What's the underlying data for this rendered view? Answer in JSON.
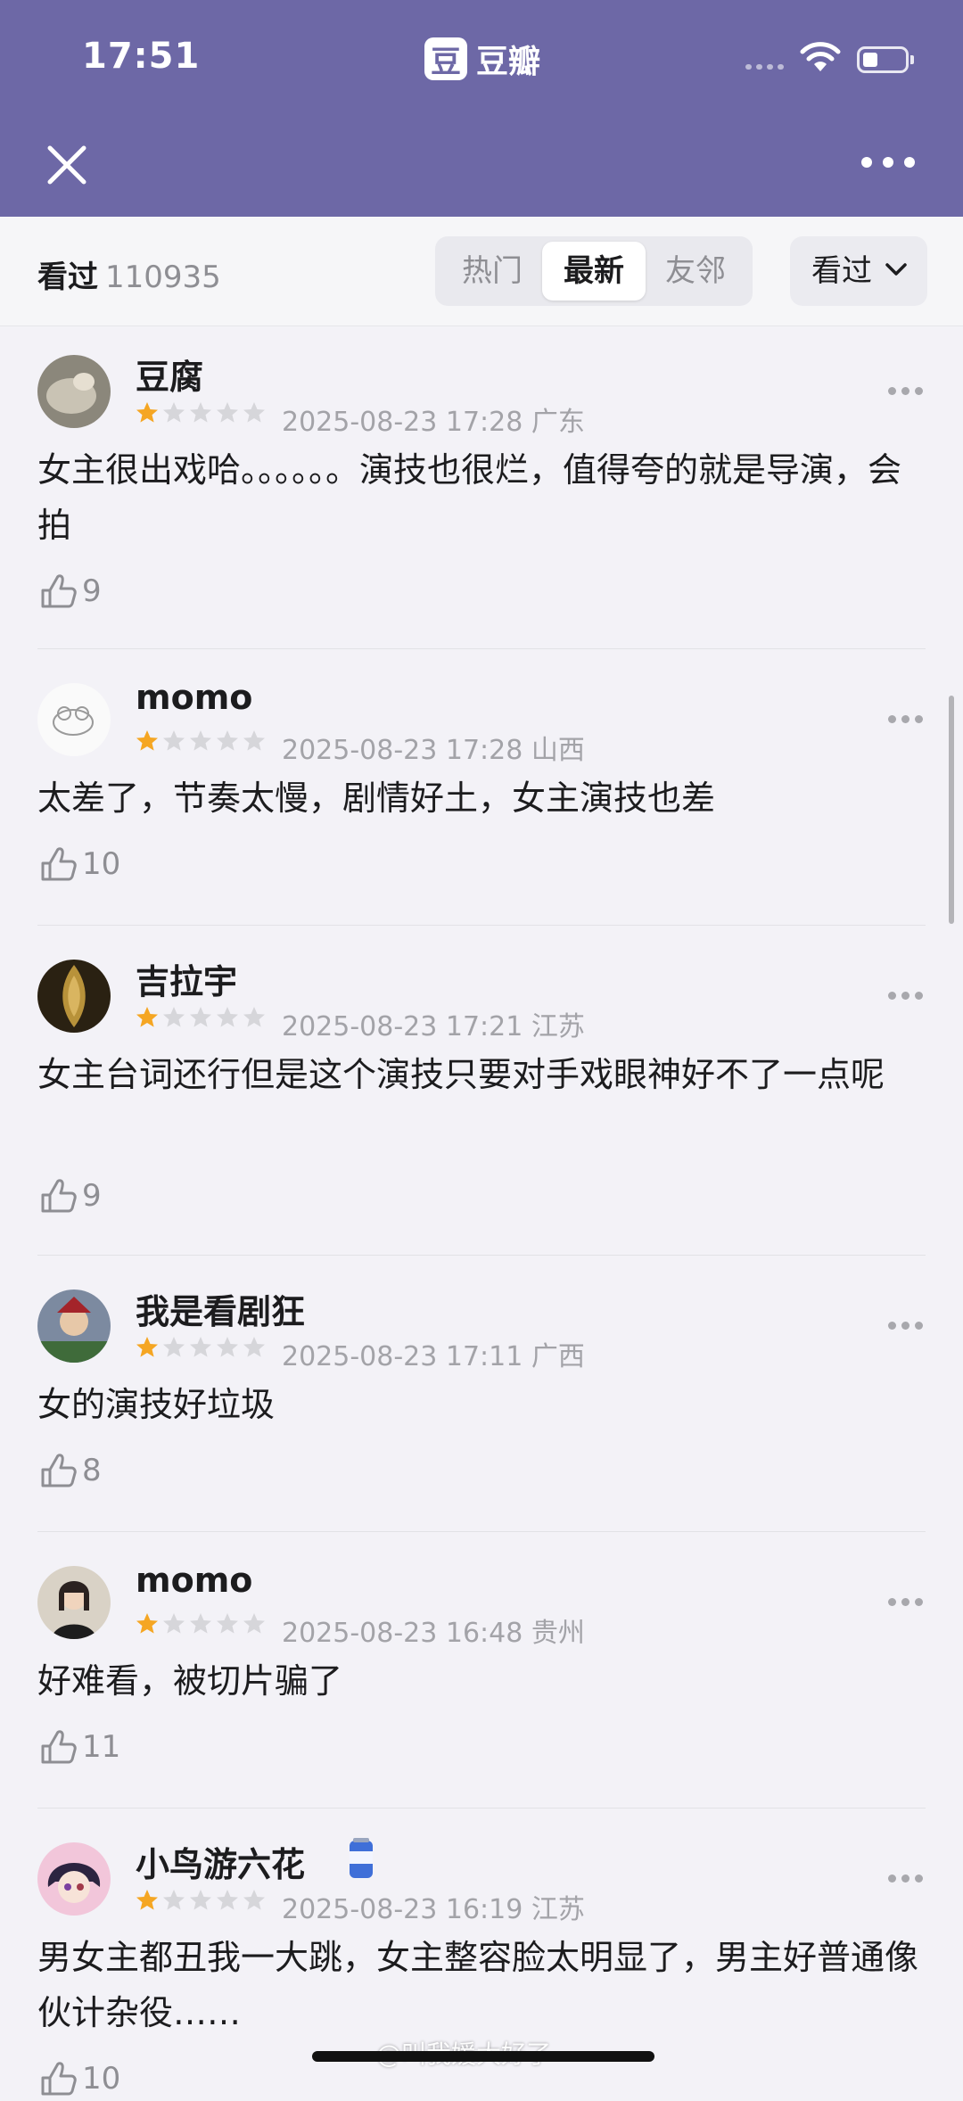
{
  "status_bar": {
    "time": "17:51",
    "app_logo_glyph": "豆",
    "app_name": "豆瓣"
  },
  "nav": {
    "title": "",
    "close_icon": "close-icon",
    "more_icon": "more-icon"
  },
  "filter": {
    "seen_label": "看过",
    "seen_count": "110935",
    "tabs": [
      {
        "label": "热门",
        "active": false
      },
      {
        "label": "最新",
        "active": true
      },
      {
        "label": "友邻",
        "active": false
      }
    ],
    "dropdown_label": "看过"
  },
  "reviews": [
    {
      "username": "豆腐",
      "rating": 1,
      "datetime": "2025-08-23 17:28",
      "location": "广东",
      "content": "女主很出戏哈。。。。。。演技也很烂，值得夸的就是导演，会拍",
      "likes": "9"
    },
    {
      "username": "momo",
      "rating": 1,
      "datetime": "2025-08-23 17:28",
      "location": "山西",
      "content": "太差了，节奏太慢，剧情好土，女主演技也差",
      "likes": "10"
    },
    {
      "username": "吉拉宇",
      "rating": 1,
      "datetime": "2025-08-23 17:21",
      "location": "江苏",
      "content": "女主台词还行但是这个演技只要对手戏眼神好不了一点呢",
      "likes": "9"
    },
    {
      "username": "我是看剧狂",
      "rating": 1,
      "datetime": "2025-08-23 17:11",
      "location": "广西",
      "content": "女的演技好垃圾",
      "likes": "8"
    },
    {
      "username": "momo",
      "rating": 1,
      "datetime": "2025-08-23 16:48",
      "location": "贵州",
      "content": "好难看，被切片骗了",
      "likes": "11"
    },
    {
      "username": "小鸟游六花",
      "rating": 1,
      "datetime": "2025-08-23 16:19",
      "location": "江苏",
      "content": "男女主都丑我一大跳，女主整容脸太明显了，男主好普通像伙计杂役……",
      "likes": "10"
    }
  ],
  "watermark": "@叫我媛大好了",
  "colors": {
    "header": "#6d68a6",
    "star_on": "#f5a623",
    "star_off": "#d6d6da",
    "background": "#f3f2f7"
  }
}
